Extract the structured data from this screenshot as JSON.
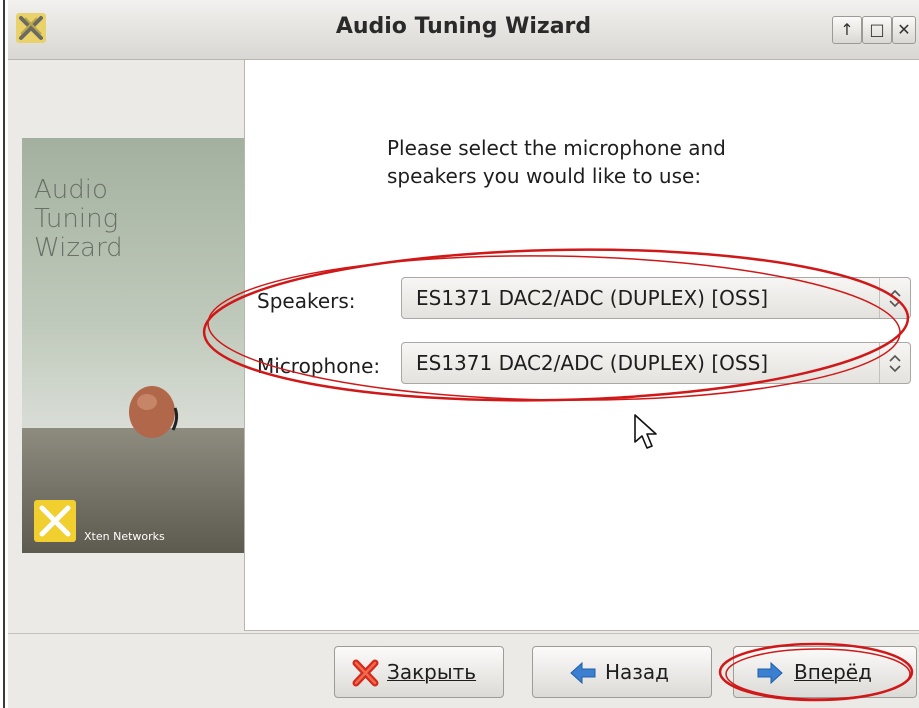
{
  "window": {
    "title": "Audio Tuning Wizard",
    "controls": [
      "↑",
      "□",
      "✕"
    ]
  },
  "banner": {
    "title": "Audio\nTuning\nWizard",
    "company": "Xten Networks"
  },
  "content": {
    "instruction": "Please select the microphone and\nspeakers you would like to use:",
    "speakers": {
      "label": "Speakers:",
      "value": "ES1371 DAC2/ADC (DUPLEX) [OSS]"
    },
    "microphone": {
      "label": "Microphone:",
      "value": "ES1371 DAC2/ADC (DUPLEX) [OSS]"
    }
  },
  "buttons": {
    "close_label": "Закрыть",
    "back_label": "Назад",
    "next_label": "Вперёд"
  },
  "icons": {
    "close": "red-x-icon",
    "back": "arrow-left-icon",
    "next": "arrow-right-icon"
  },
  "colors": {
    "annotation_red": "#d01818",
    "arrow_blue": "#3a7fd0",
    "logo_yellow": "#f0cf2e"
  }
}
